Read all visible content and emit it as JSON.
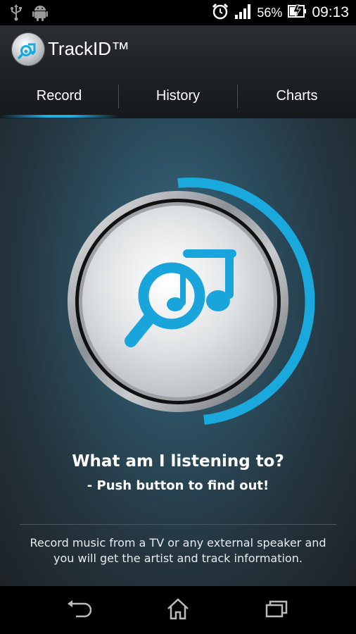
{
  "status_bar": {
    "battery_percent": "56%",
    "time": "09:13",
    "icons": [
      "usb-icon",
      "android-icon",
      "alarm-icon",
      "signal-icon",
      "battery-icon"
    ]
  },
  "action_bar": {
    "app_title": "TrackID™",
    "logo": "trackid-logo-icon"
  },
  "tabs": [
    {
      "label": "Record",
      "selected": true
    },
    {
      "label": "History",
      "selected": false
    },
    {
      "label": "Charts",
      "selected": false
    }
  ],
  "main": {
    "headline": "What am I listening to?",
    "subline": "- Push button to find out!",
    "description": "Record music from a TV or any external speaker and you will get the artist and track information."
  },
  "nav_bar": {
    "icons": [
      "back-icon",
      "home-icon",
      "recent-apps-icon"
    ]
  },
  "colors": {
    "accent": "#19b3e6",
    "background": "#25353f"
  }
}
